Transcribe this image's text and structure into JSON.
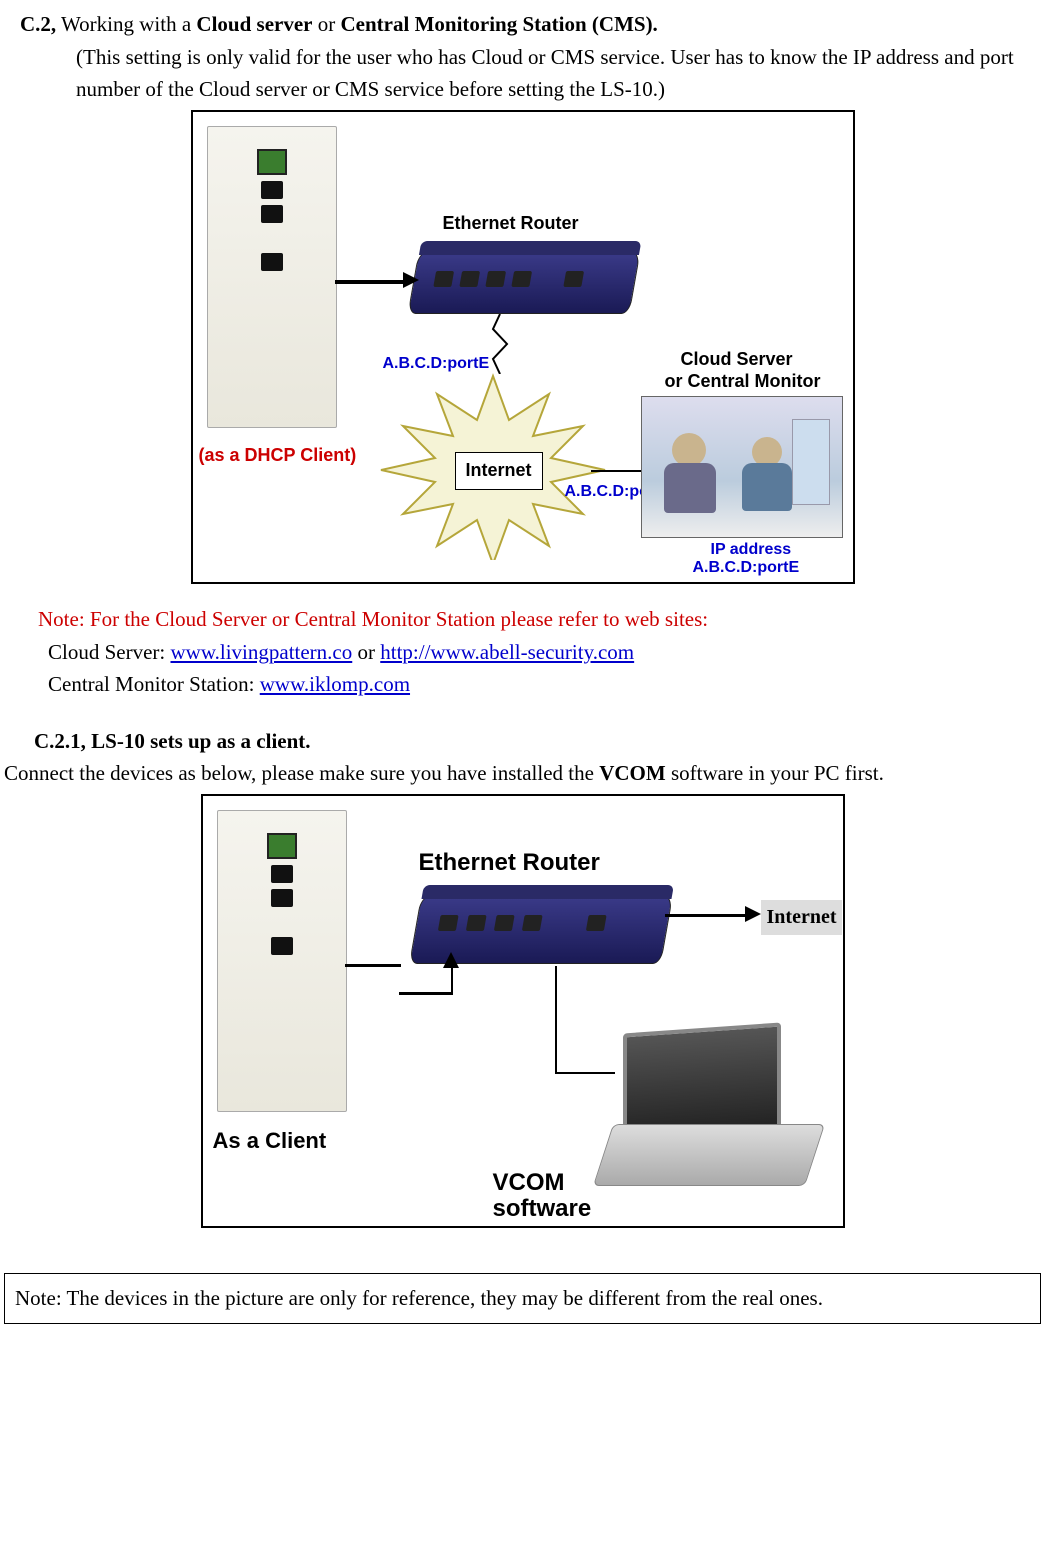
{
  "section_c2": {
    "prefix": "C.2,",
    "mid1": " Working with a ",
    "bold1": "Cloud server",
    "mid2": " or ",
    "bold2": "Central Monitoring Station (CMS)."
  },
  "c2_sub": "(This setting is only valid for the user who has Cloud or CMS service. User has to know the IP address and port number of the Cloud server or CMS service before setting the LS-10.)",
  "diagram1": {
    "ethernet_router": "Ethernet Router",
    "dhcp_client": "(as a DHCP Client)",
    "abcd1": "A.B.C.D:portE",
    "abcd2": "A.B.C.D:portE",
    "internet": "Internet",
    "cloud_line1": "Cloud Server",
    "cloud_line2": "or Central Monitor Station",
    "ip_label": "IP address",
    "ip_value": "A.B.C.D:portE"
  },
  "red_note": "Note: For the Cloud Server or Central Monitor Station please refer to web sites:",
  "cloud_server_prefix": "Cloud Server: ",
  "cloud_link1": "www.livingpattern.co",
  "cloud_or": " or ",
  "cloud_link2": "http://www.abell-security.com",
  "cms_prefix": "Central Monitor Station: ",
  "cms_link": "www.iklomp.com",
  "section_c21": "C.2.1, LS-10 sets up as a client.",
  "c21_body_pre": "Connect the devices as below, please make sure you have installed the ",
  "c21_body_bold": "VCOM",
  "c21_body_post": " software in your PC first.",
  "diagram2": {
    "ethernet_router": "Ethernet Router",
    "as_client": "As a Client",
    "internet": "Internet",
    "vcom_line1": "VCOM",
    "vcom_line2": "software"
  },
  "bottom_note": "Note: The devices in the picture are only for reference, they may be different from the real ones."
}
